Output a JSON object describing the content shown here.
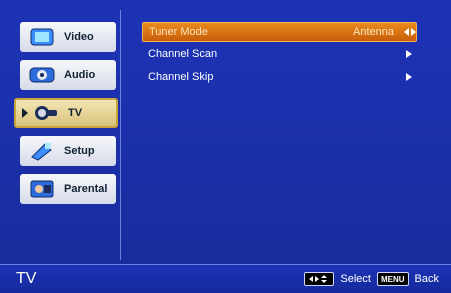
{
  "sidebar": {
    "items": [
      {
        "label": "Video",
        "icon": "video-icon",
        "active": false
      },
      {
        "label": "Audio",
        "icon": "audio-icon",
        "active": false
      },
      {
        "label": "TV",
        "icon": "tv-icon",
        "active": true
      },
      {
        "label": "Setup",
        "icon": "setup-icon",
        "active": false
      },
      {
        "label": "Parental",
        "icon": "parental-icon",
        "active": false
      }
    ]
  },
  "main": {
    "rows": [
      {
        "label": "Tuner Mode",
        "value": "Antenna",
        "selected": true
      },
      {
        "label": "Channel Scan",
        "value": "",
        "selected": false
      },
      {
        "label": "Channel Skip",
        "value": "",
        "selected": false
      }
    ]
  },
  "bottom": {
    "title": "TV",
    "hints": [
      {
        "key_icon": "navigate-icon",
        "label": "Select"
      },
      {
        "key_text": "MENU",
        "label": "Back"
      }
    ]
  },
  "colors": {
    "background": "#1d33b6",
    "highlight": "#e98a1c",
    "sidebar_tile": "#f6f7fb",
    "divider": "#6e7fdc"
  }
}
